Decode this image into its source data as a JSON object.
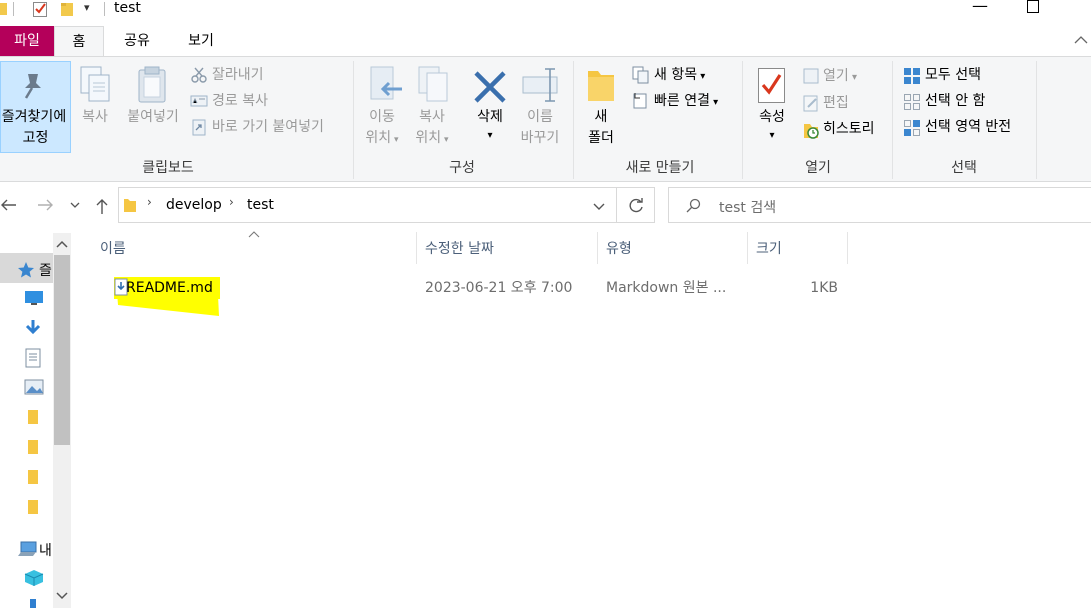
{
  "window": {
    "title": "test"
  },
  "ribbon_tabs": {
    "file": "파일",
    "home": "홈",
    "share": "공유",
    "view": "보기"
  },
  "clipboard": {
    "pin_line1": "즐겨찾기에",
    "pin_line2": "고정",
    "copy": "복사",
    "paste": "붙여넣기",
    "cut": "잘라내기",
    "copy_path": "경로 복사",
    "paste_shortcut": "바로 가기 붙여넣기",
    "group": "클립보드"
  },
  "organize": {
    "move_line1": "이동",
    "move_line2": "위치",
    "copy_line1": "복사",
    "copy_line2": "위치",
    "delete": "삭제",
    "rename_line1": "이름",
    "rename_line2": "바꾸기",
    "group": "구성"
  },
  "new": {
    "folder_line1": "새",
    "folder_line2": "폴더",
    "new_item": "새 항목",
    "easy_access": "빠른 연결",
    "group": "새로 만들기"
  },
  "open": {
    "properties": "속성",
    "open": "열기",
    "edit": "편집",
    "history": "히스토리",
    "group": "열기"
  },
  "select": {
    "select_all": "모두 선택",
    "select_none": "선택 안 함",
    "invert": "선택 영역 반전",
    "group": "선택"
  },
  "address": {
    "crumbs": [
      "develop",
      "test"
    ],
    "search_placeholder": "test 검색"
  },
  "nav": {
    "quick_access": "즐",
    "this_pc": "내"
  },
  "columns": {
    "name": "이름",
    "date": "수정한 날짜",
    "type": "유형",
    "size": "크기"
  },
  "files": [
    {
      "name": "README.md",
      "date": "2023-06-21 오후 7:00",
      "type": "Markdown 원본 ...",
      "size": "1KB"
    }
  ],
  "colors": {
    "file_tab": "#b4005a",
    "highlight": "#ffff00",
    "selected_button": "#cce8ff"
  }
}
